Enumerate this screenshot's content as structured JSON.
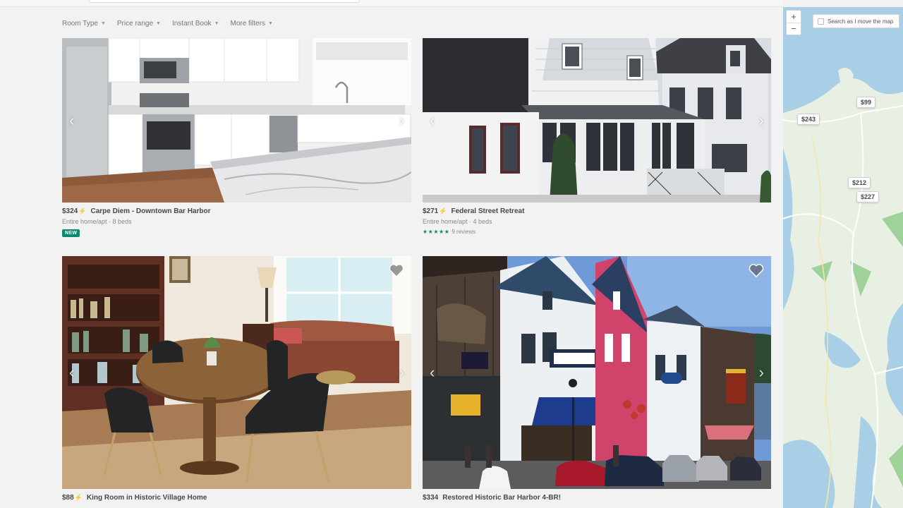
{
  "filters": [
    {
      "label": "Room Type"
    },
    {
      "label": "Price range"
    },
    {
      "label": "Instant Book"
    },
    {
      "label": "More filters"
    }
  ],
  "listings": [
    {
      "price": "$324",
      "title": "Carpe Diem - Downtown Bar Harbor",
      "details": "Entire home/apt · 8 beds",
      "badge": "NEW"
    },
    {
      "price": "$271",
      "title": "Federal Street Retreat",
      "details": "Entire home/apt · 4 beds",
      "reviews": "9 reviews"
    },
    {
      "price": "$88",
      "title": "King Room in Historic Village Home"
    },
    {
      "price": "$334",
      "title": "Restored Historic Bar Harbor 4-BR!"
    }
  ],
  "map": {
    "zoom_in": "+",
    "zoom_out": "−",
    "search_toggle": "Search as I move the map",
    "pins": [
      {
        "label": "$99"
      },
      {
        "label": "$243"
      },
      {
        "label": "$212"
      },
      {
        "label": "$227"
      }
    ]
  }
}
